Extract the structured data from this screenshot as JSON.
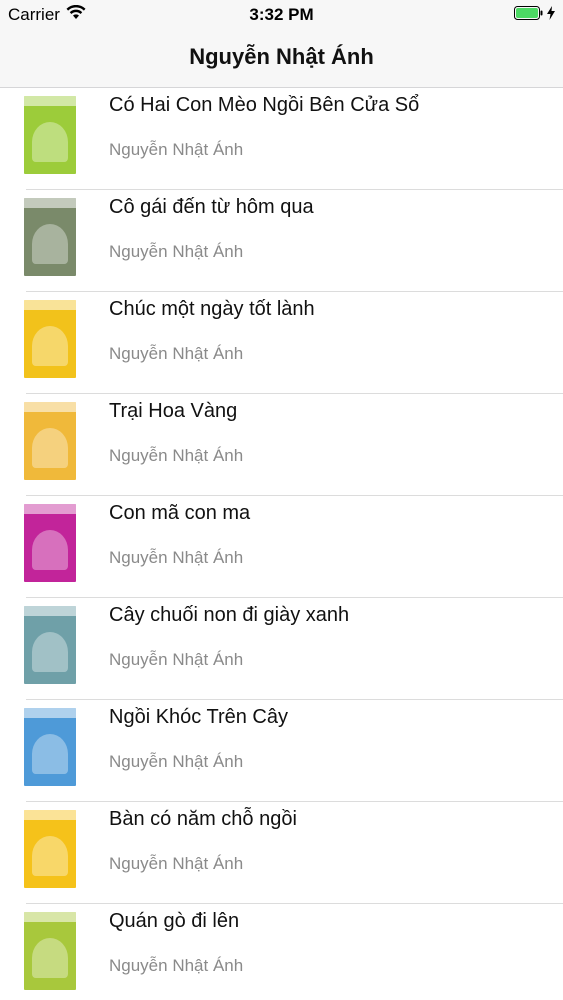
{
  "status_bar": {
    "carrier": "Carrier",
    "time": "3:32 PM",
    "battery_color": "#4cd964"
  },
  "nav": {
    "title": "Nguyễn Nhật Ánh"
  },
  "books": [
    {
      "title": "Có Hai Con Mèo Ngồi Bên Cửa Sổ",
      "author": "Nguyễn Nhật Ánh",
      "cover_color": "#9ccc3a"
    },
    {
      "title": "Cô gái đến từ hôm qua",
      "author": "Nguyễn Nhật Ánh",
      "cover_color": "#7a8a6a"
    },
    {
      "title": "Chúc một ngày tốt lành",
      "author": "Nguyễn Nhật Ánh",
      "cover_color": "#f2c21b"
    },
    {
      "title": "Trại Hoa Vàng",
      "author": "Nguyễn Nhật Ánh",
      "cover_color": "#f0b93a"
    },
    {
      "title": "Con mã con ma",
      "author": "Nguyễn Nhật Ánh",
      "cover_color": "#c2249a"
    },
    {
      "title": "Cây chuối non đi giày xanh",
      "author": "Nguyễn Nhật Ánh",
      "cover_color": "#6fa0a8"
    },
    {
      "title": "Ngồi Khóc Trên Cây",
      "author": "Nguyễn Nhật Ánh",
      "cover_color": "#4e9ad8"
    },
    {
      "title": "Bàn có năm chỗ ngồi",
      "author": "Nguyễn Nhật Ánh",
      "cover_color": "#f5c21a"
    },
    {
      "title": "Quán gò đi lên",
      "author": "Nguyễn Nhật Ánh",
      "cover_color": "#a8c83c"
    }
  ]
}
